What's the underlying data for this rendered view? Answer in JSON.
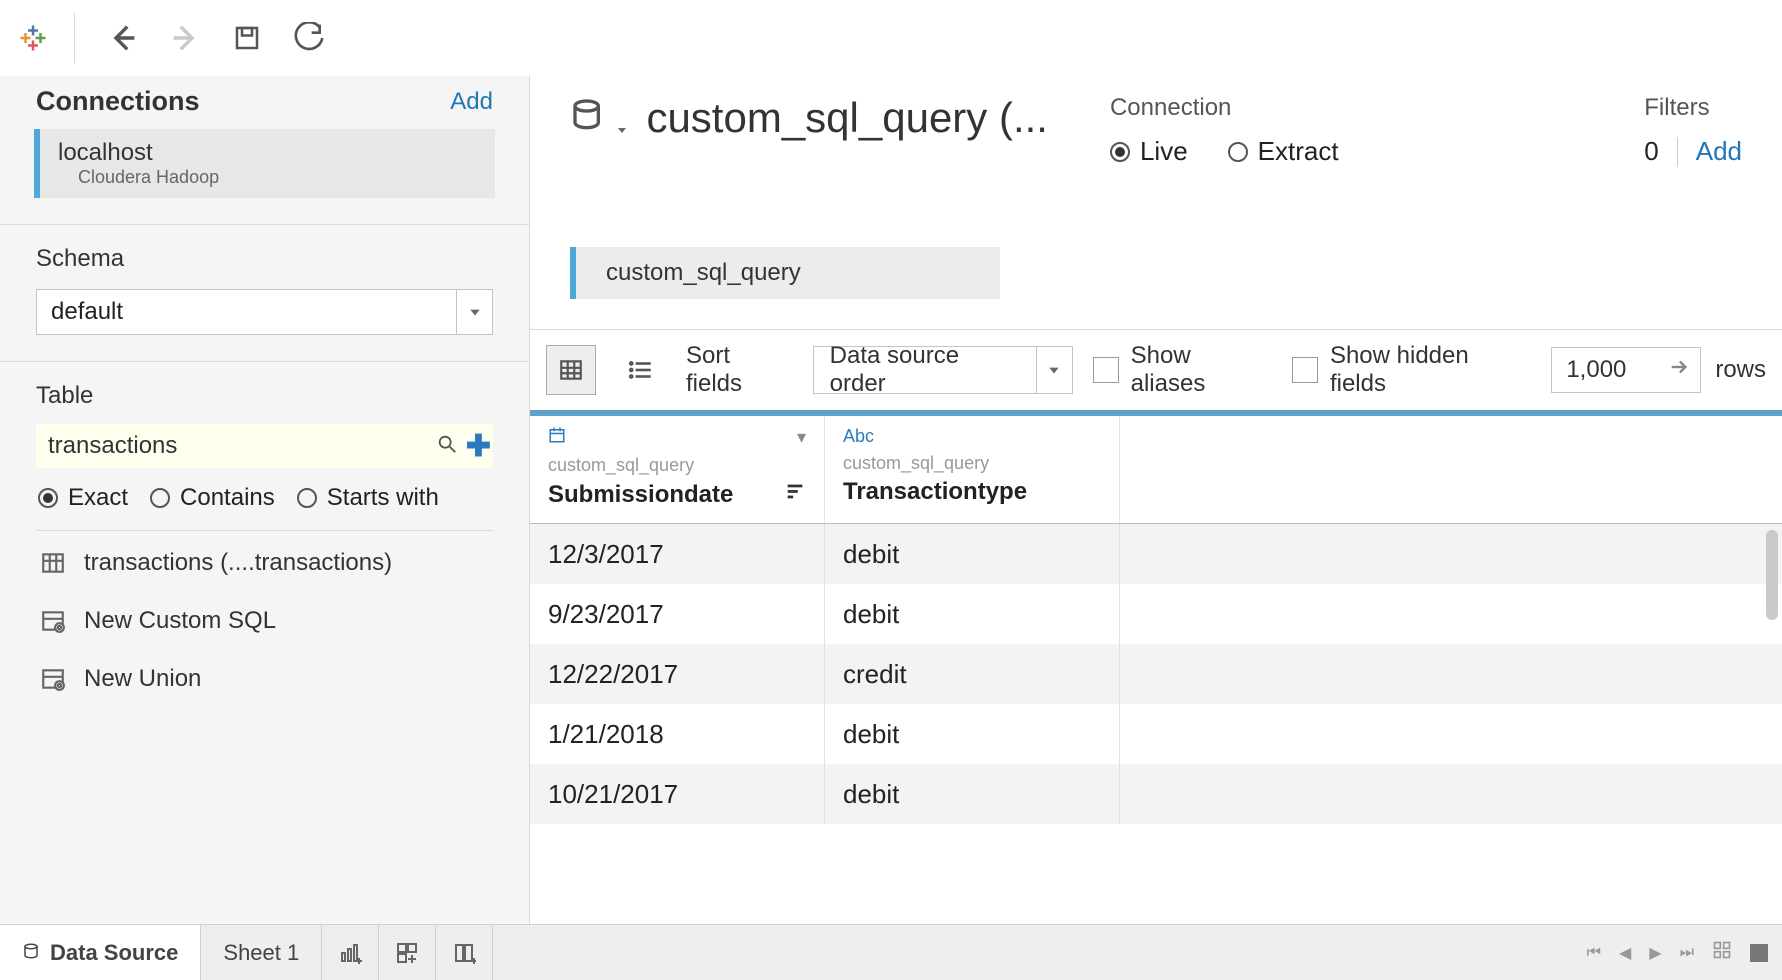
{
  "sidebar": {
    "connections": {
      "heading": "Connections",
      "add_label": "Add",
      "item": {
        "name": "localhost",
        "driver": "Cloudera Hadoop"
      }
    },
    "schema": {
      "heading": "Schema",
      "selected": "default"
    },
    "table": {
      "heading": "Table",
      "search_value": "transactions",
      "match_options": {
        "exact": "Exact",
        "contains": "Contains",
        "starts_with": "Starts with"
      },
      "items": {
        "transactions": "transactions (....transactions)",
        "custom_sql": "New Custom SQL",
        "new_union": "New Union"
      }
    }
  },
  "main": {
    "title": "custom_sql_query (...",
    "connection_label": "Connection",
    "conn_live": "Live",
    "conn_extract": "Extract",
    "filters_label": "Filters",
    "filters_count": "0",
    "filters_add": "Add",
    "logical_pill": "custom_sql_query",
    "toolbar": {
      "sort_label": "Sort fields",
      "sort_value": "Data source order",
      "show_aliases": "Show aliases",
      "show_hidden": "Show hidden fields",
      "rows_value": "1,000",
      "rows_label": "rows"
    },
    "grid": {
      "columns": [
        {
          "type_label": "",
          "type_icon": "calendar",
          "source": "custom_sql_query",
          "name": "Submissiondate"
        },
        {
          "type_label": "Abc",
          "type_icon": "abc",
          "source": "custom_sql_query",
          "name": "Transactiontype"
        }
      ],
      "rows": [
        {
          "date": "12/3/2017",
          "type": "debit"
        },
        {
          "date": "9/23/2017",
          "type": "debit"
        },
        {
          "date": "12/22/2017",
          "type": "credit"
        },
        {
          "date": "1/21/2018",
          "type": "debit"
        },
        {
          "date": "10/21/2017",
          "type": "debit"
        }
      ]
    }
  },
  "tabs": {
    "data_source": "Data Source",
    "sheet1": "Sheet 1"
  }
}
